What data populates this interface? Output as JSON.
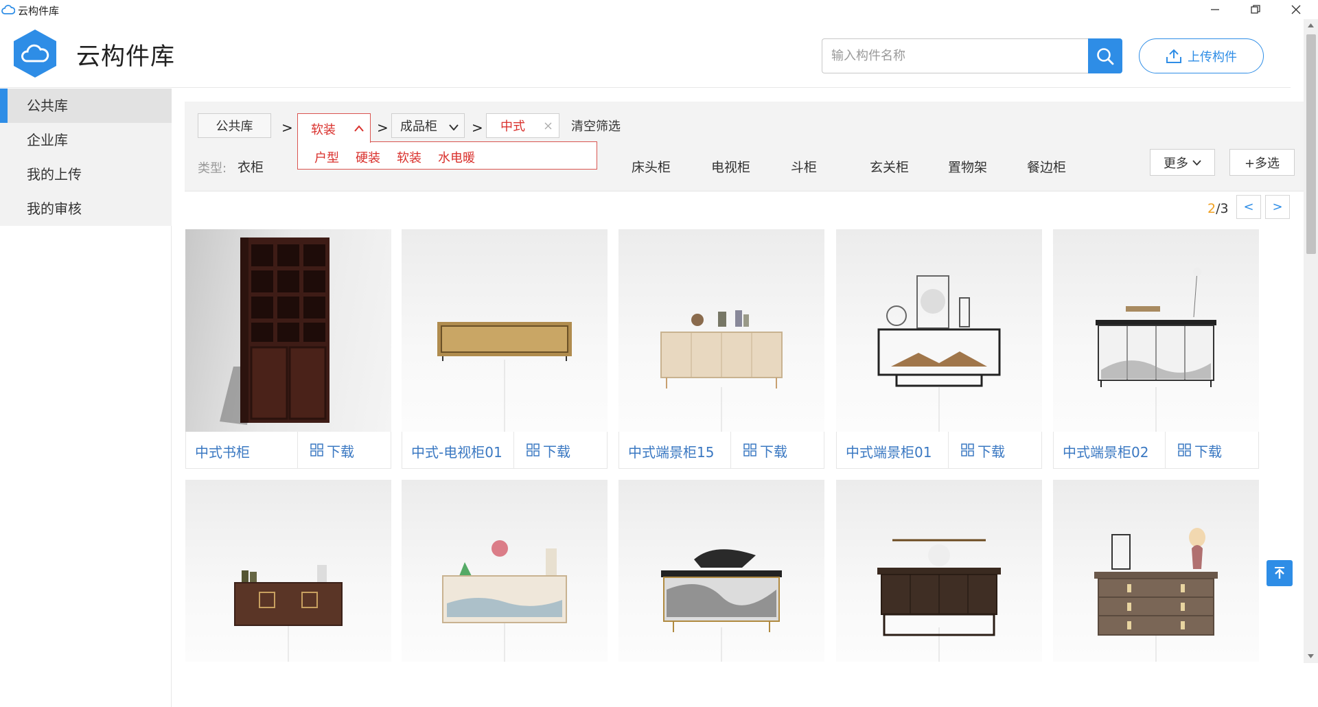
{
  "window": {
    "title": "云构件库"
  },
  "header": {
    "brand": "云构件库",
    "search_placeholder": "输入构件名称",
    "upload_label": "上传构件"
  },
  "sidebar": {
    "items": [
      {
        "label": "公共库",
        "active": true
      },
      {
        "label": "企业库"
      },
      {
        "label": "我的上传"
      },
      {
        "label": "我的审核"
      }
    ]
  },
  "filter": {
    "crumbs": [
      "公共库",
      "软装",
      "成品柜",
      "中式"
    ],
    "clear_label": "清空筛选",
    "dropdown_options": [
      "户型",
      "硬装",
      "软装",
      "水电暖"
    ],
    "type_label": "类型:",
    "types": [
      "衣柜",
      "床头柜",
      "电视柜",
      "斗柜",
      "玄关柜",
      "置物架",
      "餐边柜"
    ],
    "more_label": "更多",
    "multi_label": "+多选"
  },
  "pager": {
    "current": "2",
    "total": "/3",
    "prev": "<",
    "next": ">"
  },
  "download_label": "下载",
  "cards": [
    {
      "name": "中式书柜"
    },
    {
      "name": "中式-电视柜01"
    },
    {
      "name": "中式端景柜15"
    },
    {
      "name": "中式端景柜01"
    },
    {
      "name": "中式端景柜02"
    }
  ],
  "colors": {
    "accent": "#2e8de6",
    "active_filter": "#d9302c",
    "link": "#3a78c2"
  }
}
